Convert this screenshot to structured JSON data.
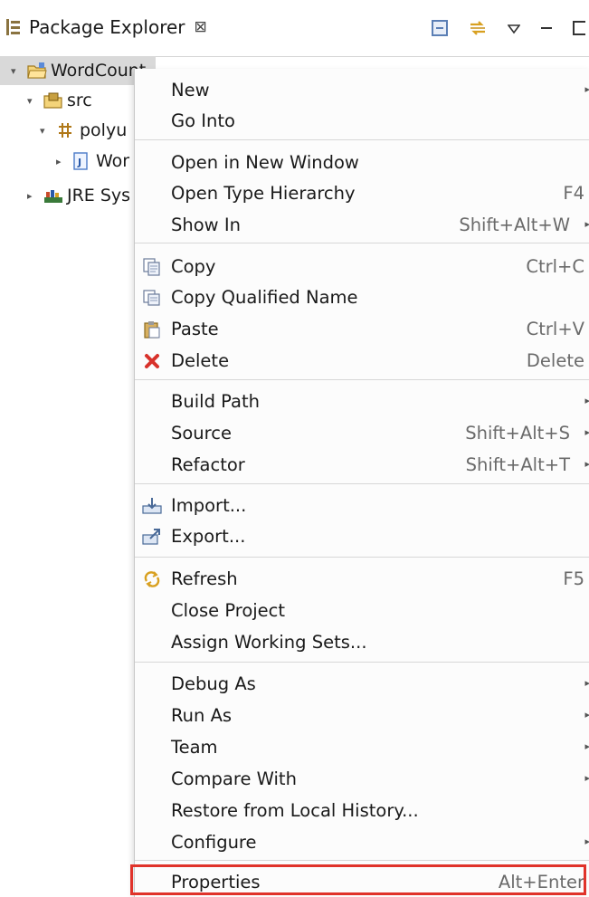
{
  "view": {
    "title": "Package Explorer",
    "close_glyph": "⊠",
    "icons": [
      "package-explorer-icon",
      "collapse-all-icon",
      "link-editor-icon",
      "view-menu-icon",
      "minimize-icon",
      "maximize-icon"
    ]
  },
  "tree": {
    "items": [
      {
        "label": "WordCount",
        "icon": "project-folder-icon"
      },
      {
        "label": "src",
        "icon": "source-folder-icon"
      },
      {
        "label": "polyu",
        "icon": "package-icon"
      },
      {
        "label": "Wor",
        "icon": "java-file-icon"
      },
      {
        "label": "JRE Sys",
        "icon": "library-icon"
      }
    ]
  },
  "menu": {
    "items": [
      {
        "label": "New",
        "accel": "",
        "submenu": true
      },
      {
        "label": "Go Into",
        "accel": "",
        "submenu": false
      },
      {
        "label": "Open in New Window",
        "accel": "",
        "submenu": false
      },
      {
        "label": "Open Type Hierarchy",
        "accel": "F4",
        "submenu": false
      },
      {
        "label": "Show In",
        "accel": "Shift+Alt+W",
        "submenu": true
      },
      {
        "label": "Copy",
        "accel": "Ctrl+C",
        "submenu": false,
        "icon": "copy-icon"
      },
      {
        "label": "Copy Qualified Name",
        "accel": "",
        "submenu": false,
        "icon": "copy-qualified-icon"
      },
      {
        "label": "Paste",
        "accel": "Ctrl+V",
        "submenu": false,
        "icon": "paste-icon"
      },
      {
        "label": "Delete",
        "accel": "Delete",
        "submenu": false,
        "icon": "delete-icon"
      },
      {
        "label": "Build Path",
        "accel": "",
        "submenu": true
      },
      {
        "label": "Source",
        "accel": "Shift+Alt+S",
        "submenu": true
      },
      {
        "label": "Refactor",
        "accel": "Shift+Alt+T",
        "submenu": true
      },
      {
        "label": "Import...",
        "accel": "",
        "submenu": false,
        "icon": "import-icon"
      },
      {
        "label": "Export...",
        "accel": "",
        "submenu": false,
        "icon": "export-icon"
      },
      {
        "label": "Refresh",
        "accel": "F5",
        "submenu": false,
        "icon": "refresh-icon"
      },
      {
        "label": "Close Project",
        "accel": "",
        "submenu": false
      },
      {
        "label": "Assign Working Sets...",
        "accel": "",
        "submenu": false
      },
      {
        "label": "Debug As",
        "accel": "",
        "submenu": true
      },
      {
        "label": "Run As",
        "accel": "",
        "submenu": true
      },
      {
        "label": "Team",
        "accel": "",
        "submenu": true
      },
      {
        "label": "Compare With",
        "accel": "",
        "submenu": true
      },
      {
        "label": "Restore from Local History...",
        "accel": "",
        "submenu": false
      },
      {
        "label": "Configure",
        "accel": "",
        "submenu": true
      },
      {
        "label": "Properties",
        "accel": "Alt+Enter",
        "submenu": false,
        "highlighted": true
      }
    ]
  },
  "colors": {
    "highlight": "#e0332a",
    "selection": "#d9d9d9",
    "delete": "#d8322b"
  }
}
